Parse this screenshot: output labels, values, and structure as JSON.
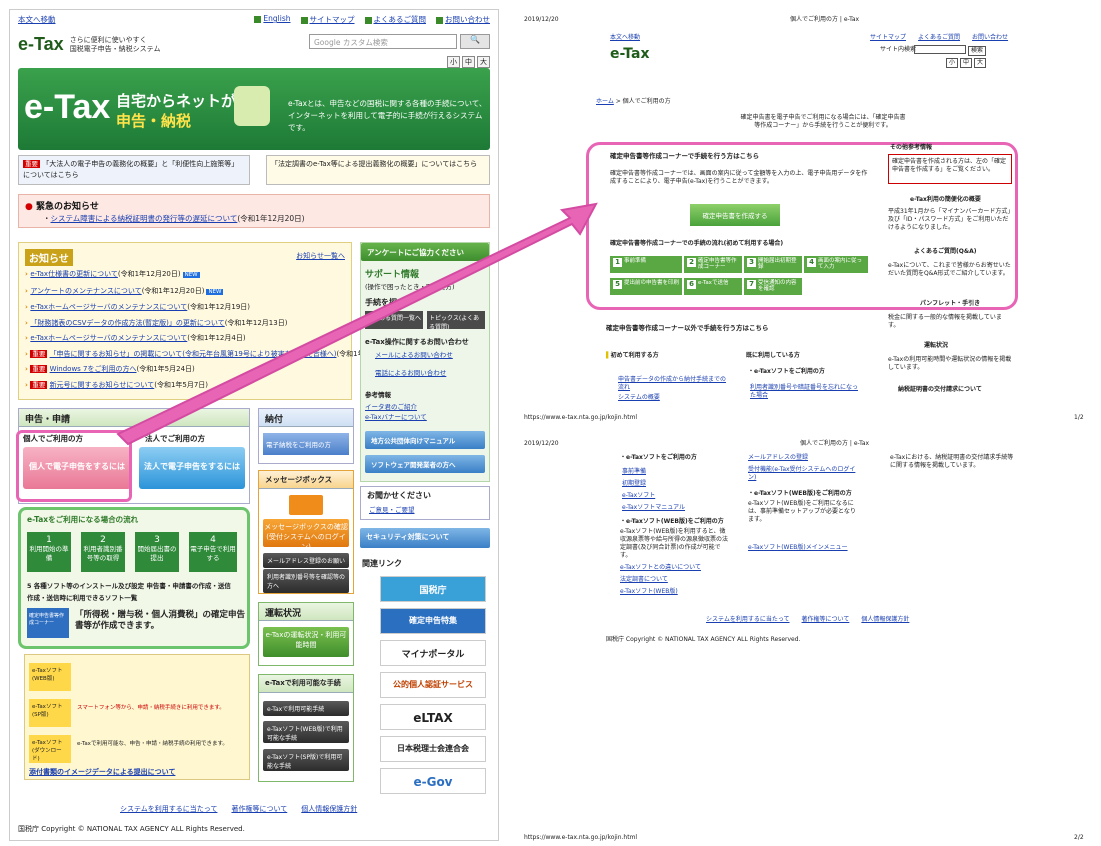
{
  "left": {
    "skip": "本文へ移動",
    "toplinks": [
      "English",
      "サイトマップ",
      "よくあるご質問",
      "お問い合わせ"
    ],
    "logo_mark": "e-Tax",
    "logo_line1": "さらに便利に使いやすく",
    "logo_line2": "国税電子申告・納税システム",
    "search_placeholder": "Google カスタム検索",
    "fontsizes": [
      "小",
      "中",
      "大"
    ],
    "banner_big": "e-Tax",
    "banner_t1": "自宅からネットが便利",
    "banner_t2": "申告・納税",
    "banner_desc": "e-Taxとは、申告などの国税に関する各種の手続について、インターネットを利用して電子的に手続が行えるシステムです。",
    "info_a": "「大法人の電子申告の義務化の概要」と「利便性向上施策等」についてはこちら",
    "info_b": "「法定調書のe-Tax等による提出義務化の概要」についてはこちら",
    "emergency_title": "緊急のお知らせ",
    "emergency_link": "システム障害による納税証明書の発行等の遅延について",
    "emergency_date": "(令和1年12月20日)",
    "news_title": "お知らせ",
    "news_more": "お知らせ一覧へ",
    "news": [
      {
        "text": "e-Tax仕様書の更新について",
        "date": "(令和1年12月20日)",
        "badge": "NEW"
      },
      {
        "text": "アンケートのメンテナンスについて",
        "date": "(令和1年12月20日)",
        "badge": "NEW"
      },
      {
        "text": "e-Taxホームページサーバのメンテナンスについて",
        "date": "(令和1年12月19日)"
      },
      {
        "text": "「財務諸表のCSVデータの作成方法(暫定版)」の更新について",
        "date": "(令和1年12月13日)"
      },
      {
        "text": "e-Taxホームページサーバのメンテナンスについて",
        "date": "(令和1年12月4日)"
      },
      {
        "red": "重要",
        "text": "「申告に関するお知らせ」の掲載について(令和元年台風第19号により被害を受けた皆様へ)",
        "date": "(令和1年11月1日)"
      },
      {
        "red": "重要",
        "text": "Windows 7をご利用の方へ",
        "date": "(令和1年5月24日)"
      },
      {
        "red": "重要",
        "text": "新元号に関するお知らせについて",
        "date": "(令和1年5月7日)"
      }
    ],
    "survey": "アンケートにご協力ください",
    "support_title": "サポート情報",
    "support_sub": "(操作で困ったとき・困った方)",
    "search_proc": "手続を探す",
    "faq_btn": "よくある質問一覧へ",
    "topics_btn": "トピックス(よくある質問)",
    "contact_title": "e-Tax操作に関するお問い合わせ",
    "contact_mail": "メールによるお問い合わせ",
    "contact_tel": "電話によるお問い合わせ",
    "ref_title": "参考情報",
    "ref1": "イータ君のご紹介",
    "ref2": "e-Taxバナーについて",
    "manual": "地方公共団体向けマニュアル",
    "dev": "ソフトウェア開発業者の方へ",
    "shinkoku": "申告・申請",
    "kojin_tab": "個人でご利用の方",
    "houjin_tab": "法人でご利用の方",
    "kojin_btn": "個人で電子申告をするには",
    "houjin_btn": "法人で電子申告をするには",
    "nozei": "納付",
    "nozei_btn": "電子納税をご利用の方",
    "msgbox": "メッセージボックス",
    "msgbox_btn": "メッセージボックスの確認(受付システムへのログイン)",
    "mail_reg": "メールアドレス登録のお願い",
    "userid": "利用者識別番号等を確認等の方へ",
    "feedback": "お聞かせください",
    "feedback_link": "ご意見・ご要望",
    "security": "セキュリティ対策について",
    "flow_title": "e-Taxをご利用になる場合の流れ",
    "steps": [
      "利用開始の準備",
      "利用者識別番号等の取得",
      "開始届出書の提出",
      "電子申告で利用する"
    ],
    "flow_step5": "5 各種ソフト等のインストール及び設定  申告書・申請書の作成・送信",
    "flow_step6": "作成・送信時に利用できるソフト一覧",
    "kakutei_small": "確定申告書等作成コーナー",
    "flow_highlight": "「所得税・贈与税・個人消費税」の確定申告書等が作成できます。",
    "soft1_lbl": "e-Taxソフト(WEB版)",
    "soft2_lbl": "e-Taxソフト(SP版)",
    "soft3_lbl": "e-Taxソフト(ダウンロード)",
    "soft_desc2": "スマートフォン等から、申請・納税手続きに利用できます。",
    "soft_desc3": "e-Taxで利用可能な、申告・申請・納税手続の利用できます。",
    "attach": "添付書類のイメージデータによる提出について",
    "unten": "運転状況",
    "unten_btn": "e-Taxの運転状況・利用可能時間",
    "proc": "e-Taxで利用可能な手続",
    "proc1": "e-Taxで利用可能手続",
    "proc2": "e-Taxソフト(WEB版)で利用可能な手続",
    "proc3": "e-Taxソフト(SP版)で利用可能な手続",
    "links": "関連リンク",
    "banners": [
      "国税庁",
      "確定申告特集",
      "マイナポータル",
      "公的個人認証サービス",
      "eLTAX",
      "日本税理士会連合会",
      "e-Gov"
    ],
    "footer_links": [
      "システムを利用するに当たって",
      "著作権等について",
      "個人情報保護方針"
    ],
    "copyright": "国税庁  Copyright © NATIONAL TAX AGENCY ALL Rights Reserved."
  },
  "right": {
    "date": "2019/12/20",
    "title": "個人でご利用の方 | e-Tax",
    "skip": "本文へ移動",
    "toplinks": [
      "サイトマップ",
      "よくあるご質問",
      "お問い合わせ"
    ],
    "site_search": "サイト内検索",
    "search_btn": "検索",
    "fontsizes": [
      "小",
      "中",
      "大"
    ],
    "logo_mark": "e-Tax",
    "breadcrumb_home": "ホーム",
    "breadcrumb_cur": "個人でご利用の方",
    "intro": "確定申告書を電子申告でご利用になる場合には、「確定申告書等作成コーナー」から手続を行うことが便利です。",
    "sec1_title": "確定申告書等作成コーナーで手続を行う方はこちら",
    "sec1_desc": "確定申告書等作成コーナーでは、画面の案内に従って金額等を入力の上、電子申告用データを作成することにより、電子申告(e-Tax)を行うことができます。",
    "kakutei_btn": "確定申告書を作成する",
    "flow_title": "確定申告書等作成コーナーでの手続の流れ(初めて利用する場合)",
    "flow": [
      "事前準備",
      "確定申告書等作成コーナー",
      "開始届出初期登録",
      "画面の案内に従って入力",
      "提出前の申告書を印刷",
      "e-Taxで送信",
      "受信通知の内容を確認"
    ],
    "other_title": "その他参考情報",
    "red_note": "確定申告書を作成される方は、左の「確定申告書を作成する」をご覧ください。",
    "etax_my": "e-Tax利用の簡便化の概要",
    "etax_my_desc": "平成31年1月から「マイナンバーカード方式」及び「ID・パスワード方式」をご利用いただけるようになりました。",
    "faq": "よくあるご質問(Q&A)",
    "faq_desc": "e-Taxについて、これまで皆様からお寄せいただいた質問をQ&A形式でご紹介しています。",
    "pamph": "パンフレット・手引き",
    "pamph_desc": "税金に関する一般的な情報を掲載しています。",
    "unten": "運転状況",
    "unten_desc": "e-Taxの利用可能時間や運転状況の情報を掲載しています。",
    "nozei_shomei": "納税証明書の交付請求について",
    "sec2_title": "確定申告書等作成コーナー以外で手続を行う方はこちら",
    "first": "初めて利用する方",
    "first_l1": "申告書データの作成から納付手続までの流れ",
    "first_l2": "システムの概要",
    "already": "既に利用している方",
    "already_sub": "・e-Taxソフトをご利用の方",
    "already_l": "利用者識別番号や暗証番号を忘れになった場合",
    "url": "https://www.e-tax.nta.go.jp/kojin.html",
    "page1": "1/2",
    "page2": "2/2",
    "p2_soft": "・e-Taxソフトをご利用の方",
    "p2_links": [
      "事前準備",
      "初期登録",
      "e-Taxソフト",
      "e-Taxソフトマニュアル"
    ],
    "p2_web": "・e-Taxソフト(WEB版)をご利用の方",
    "p2_web_desc": "e-Taxソフト(WEB版)を利用すると、徴収源泉票等や給与所得の源泉徴収票の法定調書(及び同合計票)の作成が可能です。",
    "p2_web_links": [
      "e-Taxソフトとの違いについて",
      "法定調書について",
      "e-Taxソフト(WEB版)"
    ],
    "p2_mail": "メールアドレスの登録",
    "p2_login": "受付機能(e-Tax受付システムへのログイン)",
    "p2_web2": "・e-Taxソフト(WEB版)をご利用の方",
    "p2_web2_desc": "e-Taxソフト(WEB版)をご利用になるには、事前準備セットアップが必要となります。",
    "p2_webmenu": "e-Taxソフト(WEB版)メインメニュー",
    "p2_right": "e-Taxにおける、納税証明書の交付請求手続等に関する情報を掲載しています。",
    "p2_footer": [
      "システムを利用するに当たって",
      "著作権等について",
      "個人情報保護方針"
    ],
    "p2_copy": "国税庁  Copyright © NATIONAL TAX AGENCY ALL Rights Reserved."
  },
  "colors": {
    "green": "#2f8a3a",
    "pink": "#e865b6",
    "link": "#1a3fb0"
  }
}
